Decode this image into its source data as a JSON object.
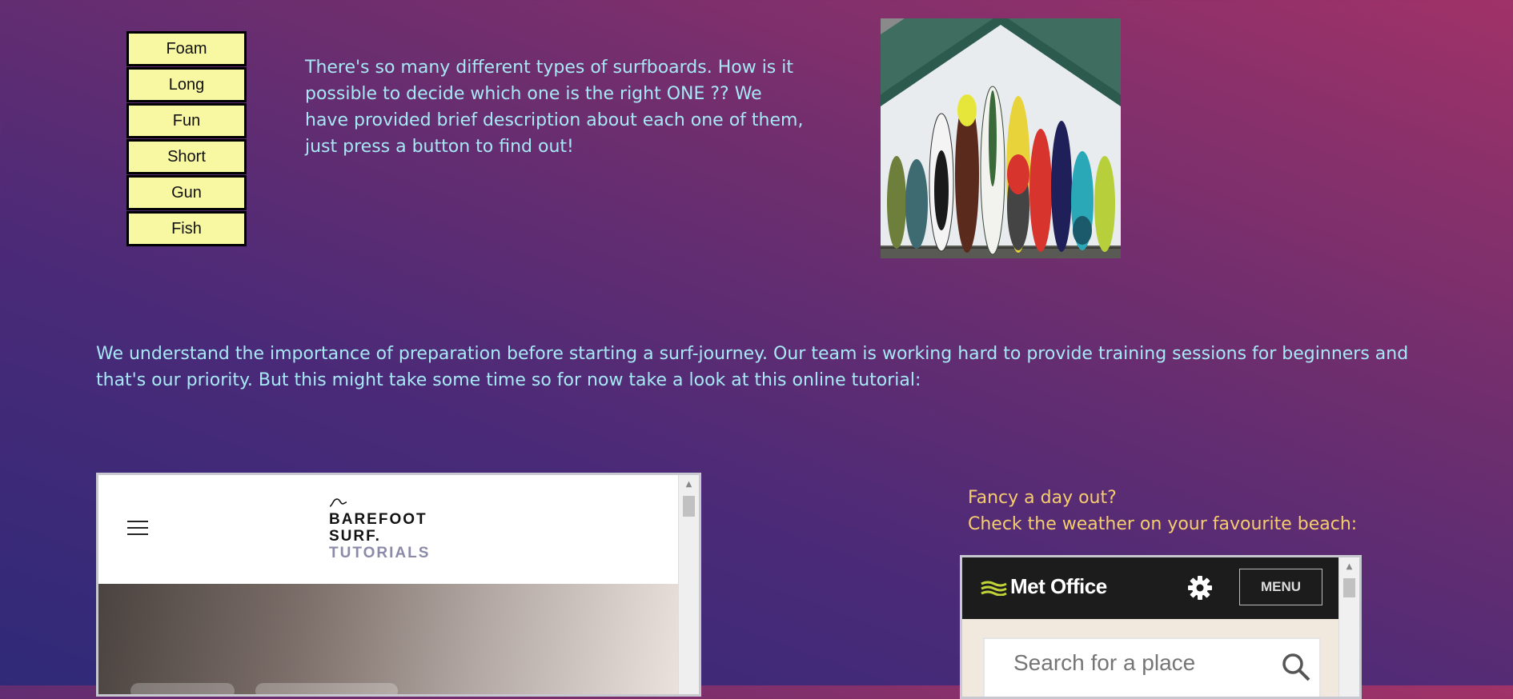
{
  "board_buttons": [
    {
      "label": "Foam"
    },
    {
      "label": "Long"
    },
    {
      "label": "Fun"
    },
    {
      "label": "Short"
    },
    {
      "label": "Gun"
    },
    {
      "label": "Fish"
    }
  ],
  "intro_text": "There's so many different types of surfboards. How is it possible to decide which one is the right ONE ?? We have provided brief description about each one of them, just press a button to find out!",
  "preparation_text": "We understand the importance of preparation before starting a surf-journey. Our team is working hard to provide training sessions for beginners and that's our priority. But this might take some time so for now take a look at this online tutorial:",
  "surf_embed": {
    "logo_line1": "BAREFOOT",
    "logo_line2": "SURF.",
    "logo_line3": "TUTORIALS"
  },
  "weather": {
    "line1": "Fancy a day out?",
    "line2": "Check the weather on your favourite beach:"
  },
  "met_embed": {
    "brand": "Met Office",
    "menu_label": "MENU",
    "search_placeholder": "Search for a place"
  },
  "colors": {
    "button_bg": "#f8f8a2",
    "text_cyan": "#a7e8f5",
    "text_yellow": "#f6cd6e"
  }
}
